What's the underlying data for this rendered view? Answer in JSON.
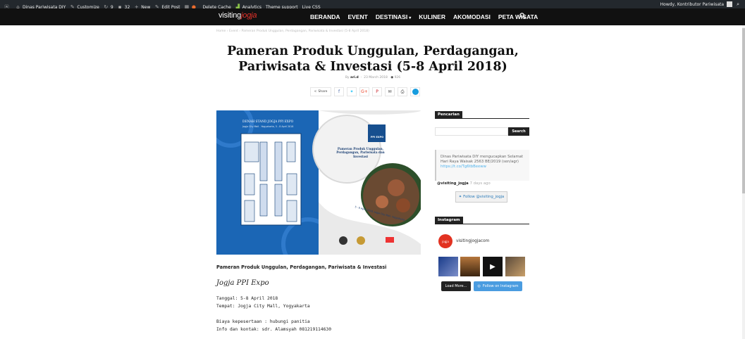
{
  "adminbar": {
    "site": "Dinas Pariwisata DIY",
    "customize": "Customize",
    "updates": "9",
    "comments": "32",
    "new": "New",
    "edit_post": "Edit Post",
    "delete_cache": "Delete Cache",
    "analytics": "Analytics",
    "theme_support": "Theme support",
    "live_css": "Live CSS",
    "howdy": "Howdy, Kontributor Pariwisata"
  },
  "logo": {
    "part1": "visiting",
    "part2": "jogja"
  },
  "nav": {
    "items": [
      "BERANDA",
      "EVENT",
      "DESTINASI",
      "KULINER",
      "AKOMODASI",
      "PETA WISATA"
    ]
  },
  "breadcrumb": "Home  ›  Event  ›  Pameran Produk Unggulan, Perdagangan, Pariwisata & Investasi (5-8 April 2018)",
  "article": {
    "title": "Pameran Produk Unggulan, Perdagangan, Pariwisata & Investasi (5-8 April 2018)",
    "by": "By",
    "author": "ari.d",
    "date": "23 March 2018",
    "views": "926",
    "share_label": "Share",
    "caption": "Pameran Produk Unggulan, Perdagangan, Pariwisata & Investasi",
    "signature": "Jogja PPI Expo",
    "lines": [
      "Tanggal: 5-8 April 2018",
      "Tempat: Jogja City Mall, Yogyakarta",
      "",
      "Biaya kepesertaan : hubungi panitia",
      "Info dan kontak: sdr. Alamsyah 081219114630"
    ]
  },
  "poster": {
    "denah_title": "DENAH STAND JOGJA PPI EXPO",
    "denah_sub": "Jogja City Mall - Yogyakarta, 5 - 8 April 2018",
    "expo_logo": "PPI EXPO",
    "right_title": "Pameran Produk Unggulan, Perdagangan, Pariwisata dan Investasi",
    "date_line": "5 - 8 April 2018, Jogja City Mall, Yogyakarta"
  },
  "sidebar": {
    "search_title": "Pencarian",
    "search_button": "Search",
    "tweet_text": "Dinas Pariwisata DIY mengucapkan Selamat Hari Raya Waisak 2563 BE/2019  (sen/agr)",
    "tweet_link": "https://t.co/Tg6tbBeeww",
    "tweet_user": "@visiting_jogja",
    "tweet_ago": "7 days ago",
    "follow_label": "Follow @visiting_jogja",
    "instagram_title": "Instagram",
    "instagram_user": "visitingjogjacom",
    "load_more": "Load More...",
    "follow_instagram": "Follow on Instagram"
  }
}
